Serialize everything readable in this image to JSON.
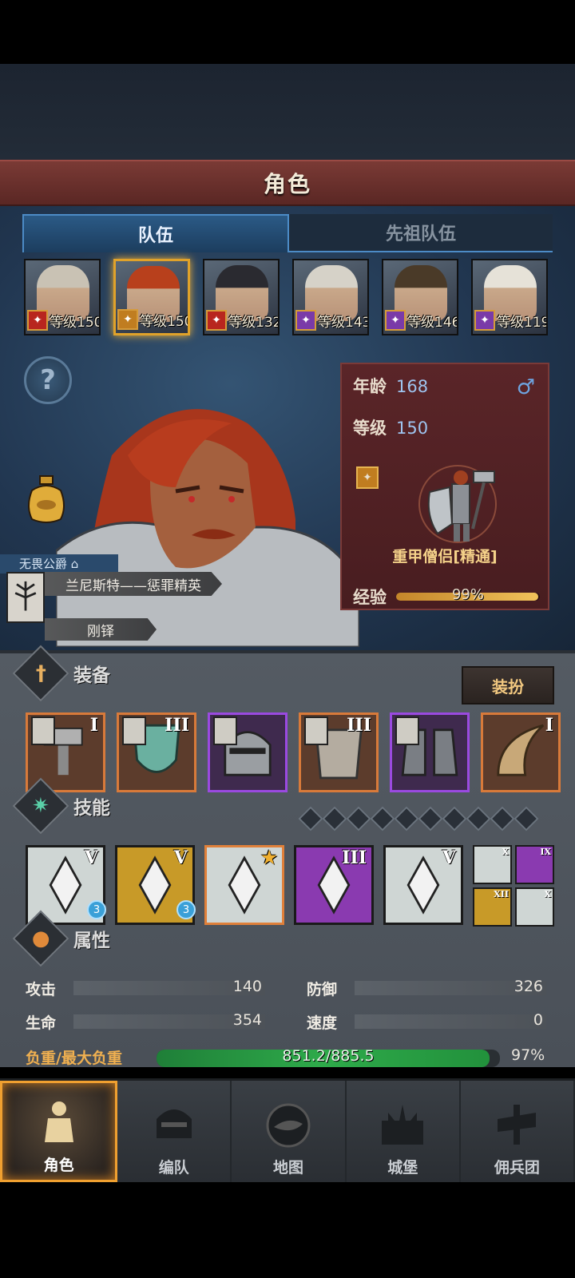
{
  "header": {
    "title": "角色"
  },
  "tabs": [
    {
      "label": "队伍",
      "active": true
    },
    {
      "label": "先祖队伍",
      "active": false
    }
  ],
  "team": [
    {
      "level": "等级150",
      "hair": "#c9c2b4",
      "badge": "#b8261e",
      "selected": false
    },
    {
      "level": "等级150",
      "hair": "#b8401c",
      "badge": "#c07d20",
      "selected": true
    },
    {
      "level": "等级132",
      "hair": "#2a2a30",
      "badge": "#b8261e",
      "selected": false
    },
    {
      "level": "等级143",
      "hair": "#d6d2c8",
      "badge": "#7a3aa8",
      "selected": false
    },
    {
      "level": "等级146",
      "hair": "#4a3a28",
      "badge": "#7a3aa8",
      "selected": false
    },
    {
      "level": "等级119",
      "hair": "#e6e2d8",
      "badge": "#7a3aa8",
      "selected": false
    }
  ],
  "hero": {
    "age_label": "年龄",
    "age": "168",
    "level_label": "等级",
    "level": "150",
    "gender": "♂",
    "class_name": "重甲僧侣[精通]",
    "exp_label": "经验",
    "exp_text": "99%",
    "exp_fraction": 0.99,
    "title": "无畏公爵",
    "name": "兰尼斯特——惩罪精英",
    "subname": "刚铎"
  },
  "equipment": {
    "label": "装备",
    "dress_button": "装扮",
    "slots": [
      {
        "tier": "I",
        "rarity": "orange"
      },
      {
        "tier": "III",
        "rarity": "orange"
      },
      {
        "tier": "",
        "rarity": "epic"
      },
      {
        "tier": "III",
        "rarity": "orange"
      },
      {
        "tier": "",
        "rarity": "epic"
      },
      {
        "tier": "I",
        "rarity": "orange"
      }
    ]
  },
  "skills": {
    "label": "技能",
    "slots": [
      {
        "tier": "V",
        "gem": "3",
        "style": ""
      },
      {
        "tier": "V",
        "gem": "3",
        "style": "gold"
      },
      {
        "tier": "★",
        "gem": "",
        "style": "orange"
      },
      {
        "tier": "III",
        "gem": "",
        "style": "purple"
      },
      {
        "tier": "V",
        "gem": "",
        "style": ""
      }
    ],
    "passives": [
      {
        "tier": "X",
        "style": ""
      },
      {
        "tier": "IX",
        "style": "purple"
      },
      {
        "tier": "XII",
        "style": "gold"
      },
      {
        "tier": "X",
        "style": ""
      }
    ]
  },
  "attributes": {
    "label": "属性",
    "attack_label": "攻击",
    "attack": "140",
    "defense_label": "防御",
    "defense": "326",
    "hp_label": "生命",
    "hp": "354",
    "speed_label": "速度",
    "speed": "0",
    "load_label": "负重/最大负重",
    "load_text": "851.2/885.5",
    "load_pct": "97%",
    "load_fraction": 0.97
  },
  "nav": [
    {
      "label": "角色",
      "icon": "knight-icon",
      "active": true
    },
    {
      "label": "编队",
      "icon": "helmet-icon",
      "active": false
    },
    {
      "label": "地图",
      "icon": "compass-map-icon",
      "active": false
    },
    {
      "label": "城堡",
      "icon": "castle-icon",
      "active": false
    },
    {
      "label": "佣兵团",
      "icon": "mercenary-banner-icon",
      "active": false
    }
  ]
}
